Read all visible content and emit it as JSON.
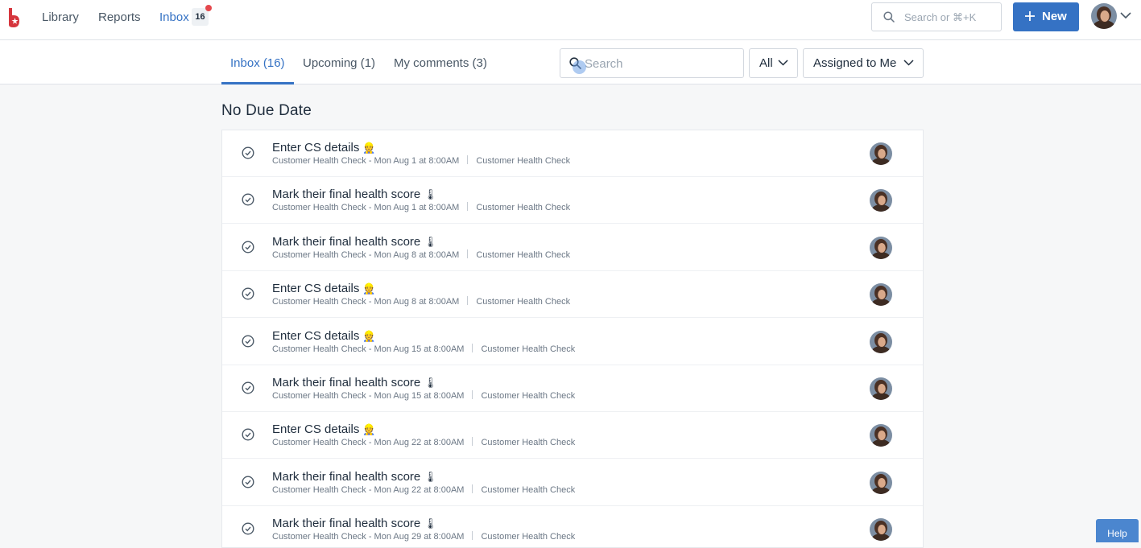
{
  "nav": {
    "library": "Library",
    "reports": "Reports",
    "inbox": "Inbox",
    "inbox_count": "16"
  },
  "global_search": {
    "placeholder": "Search or ⌘+K"
  },
  "new_button": {
    "label": "New"
  },
  "tabs": [
    {
      "label": "Inbox (16)",
      "active": true
    },
    {
      "label": "Upcoming (1)",
      "active": false
    },
    {
      "label": "My comments (3)",
      "active": false
    }
  ],
  "filters": {
    "search_placeholder": "Search",
    "type": "All",
    "assignee": "Assigned to Me"
  },
  "section": {
    "title": "No Due Date"
  },
  "tasks": [
    {
      "title": "Enter CS details",
      "emoji": "👷",
      "meta": "Customer Health Check - Mon Aug 1 at 8:00AM",
      "workflow": "Customer Health Check"
    },
    {
      "title": "Mark their final health score",
      "emoji": "🌡",
      "meta": "Customer Health Check - Mon Aug 1 at 8:00AM",
      "workflow": "Customer Health Check"
    },
    {
      "title": "Mark their final health score",
      "emoji": "🌡",
      "meta": "Customer Health Check - Mon Aug 8 at 8:00AM",
      "workflow": "Customer Health Check"
    },
    {
      "title": "Enter CS details",
      "emoji": "👷",
      "meta": "Customer Health Check - Mon Aug 8 at 8:00AM",
      "workflow": "Customer Health Check"
    },
    {
      "title": "Enter CS details",
      "emoji": "👷",
      "meta": "Customer Health Check - Mon Aug 15 at 8:00AM",
      "workflow": "Customer Health Check"
    },
    {
      "title": "Mark their final health score",
      "emoji": "🌡",
      "meta": "Customer Health Check - Mon Aug 15 at 8:00AM",
      "workflow": "Customer Health Check"
    },
    {
      "title": "Enter CS details",
      "emoji": "👷",
      "meta": "Customer Health Check - Mon Aug 22 at 8:00AM",
      "workflow": "Customer Health Check"
    },
    {
      "title": "Mark their final health score",
      "emoji": "🌡",
      "meta": "Customer Health Check - Mon Aug 22 at 8:00AM",
      "workflow": "Customer Health Check"
    },
    {
      "title": "Mark their final health score",
      "emoji": "🌡",
      "meta": "Customer Health Check - Mon Aug 29 at 8:00AM",
      "workflow": "Customer Health Check"
    }
  ],
  "help": {
    "label": "Help"
  },
  "colors": {
    "accent": "#3572c4",
    "badge_dot": "#e5484d",
    "help": "#4b86cf"
  }
}
